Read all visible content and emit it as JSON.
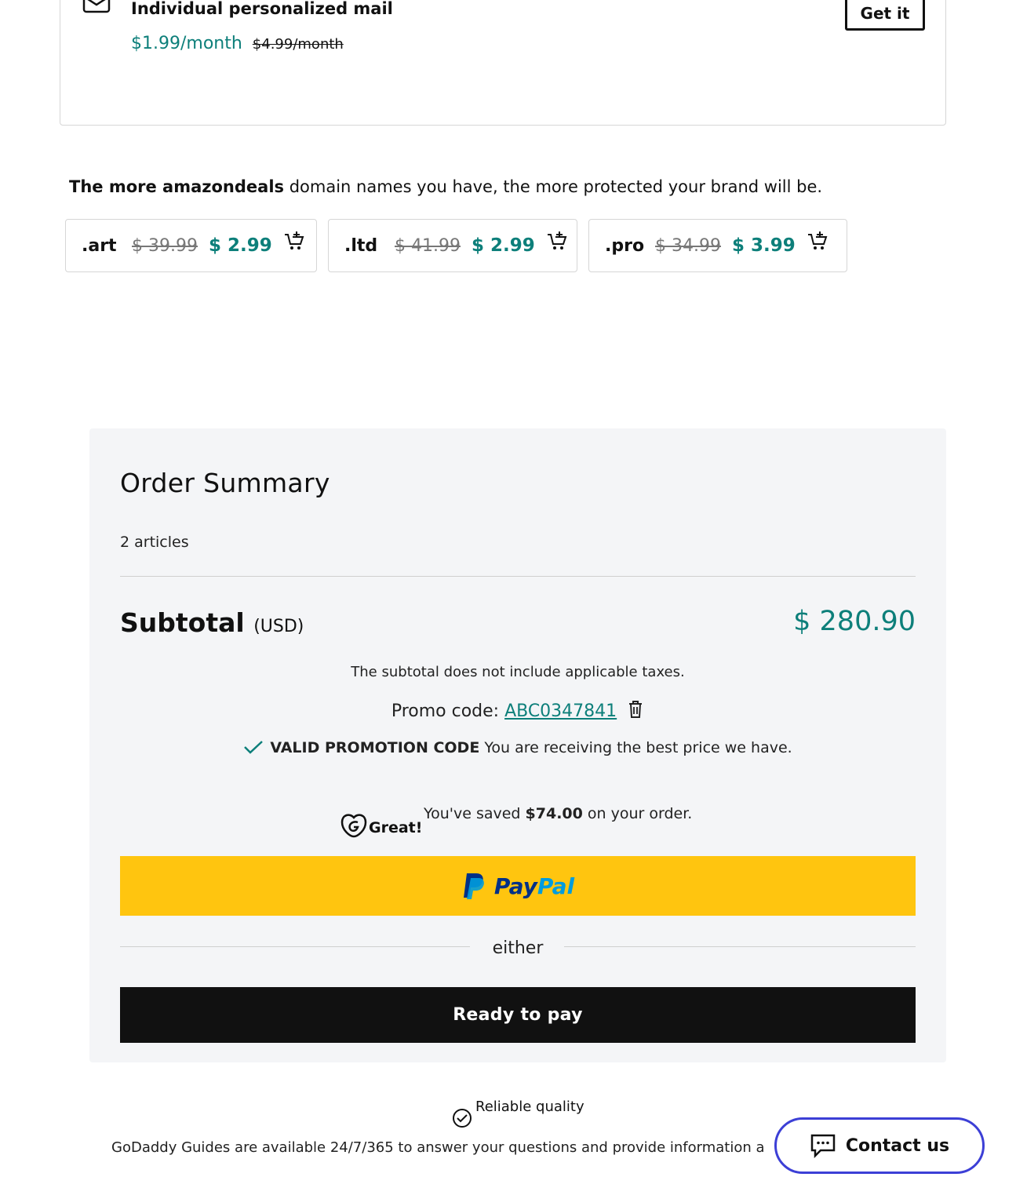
{
  "mail_offer": {
    "title": "Individual personalized mail",
    "price": "$1.99/month",
    "old_price": "$4.99/month",
    "button_label": "Get it"
  },
  "domain_upsell": {
    "message_bold": "The more amazondeals",
    "message_rest": " domain names you have, the more protected your brand will be.",
    "tlds": [
      {
        "name": ".art",
        "old_price": "$ 39.99",
        "price": "$ 2.99"
      },
      {
        "name": ".ltd",
        "old_price": "$ 41.99",
        "price": "$ 2.99"
      },
      {
        "name": ".pro",
        "old_price": "$ 34.99",
        "price": "$ 3.99"
      }
    ]
  },
  "order_summary": {
    "title": "Order Summary",
    "item_count": "2 articles",
    "subtotal_label": "Subtotal",
    "subtotal_currency": "(USD)",
    "subtotal_value": "$ 280.90",
    "tax_note": "The subtotal does not include applicable taxes.",
    "promo_label": "Promo code: ",
    "promo_code": "ABC0347841",
    "valid_strong": "VALID PROMOTION CODE",
    "valid_rest": " You are receiving the best price we have.",
    "great_label": "Great!",
    "saved_prefix": "You've saved ",
    "saved_amount": "$74.00",
    "saved_suffix": " on your order.",
    "paypal_pay": "Pay",
    "paypal_pal": "Pal",
    "or_label": "either",
    "pay_button": "Ready to pay"
  },
  "footer": {
    "quality_label": "Reliable quality",
    "guides_text": "GoDaddy Guides are available 24/7/365 to answer your questions and provide information a",
    "contact_label": "Contact us"
  },
  "colors": {
    "accent_teal": "#0d7f7a",
    "paypal_yellow": "#ffc50f",
    "contact_border": "#3c3fd6"
  }
}
